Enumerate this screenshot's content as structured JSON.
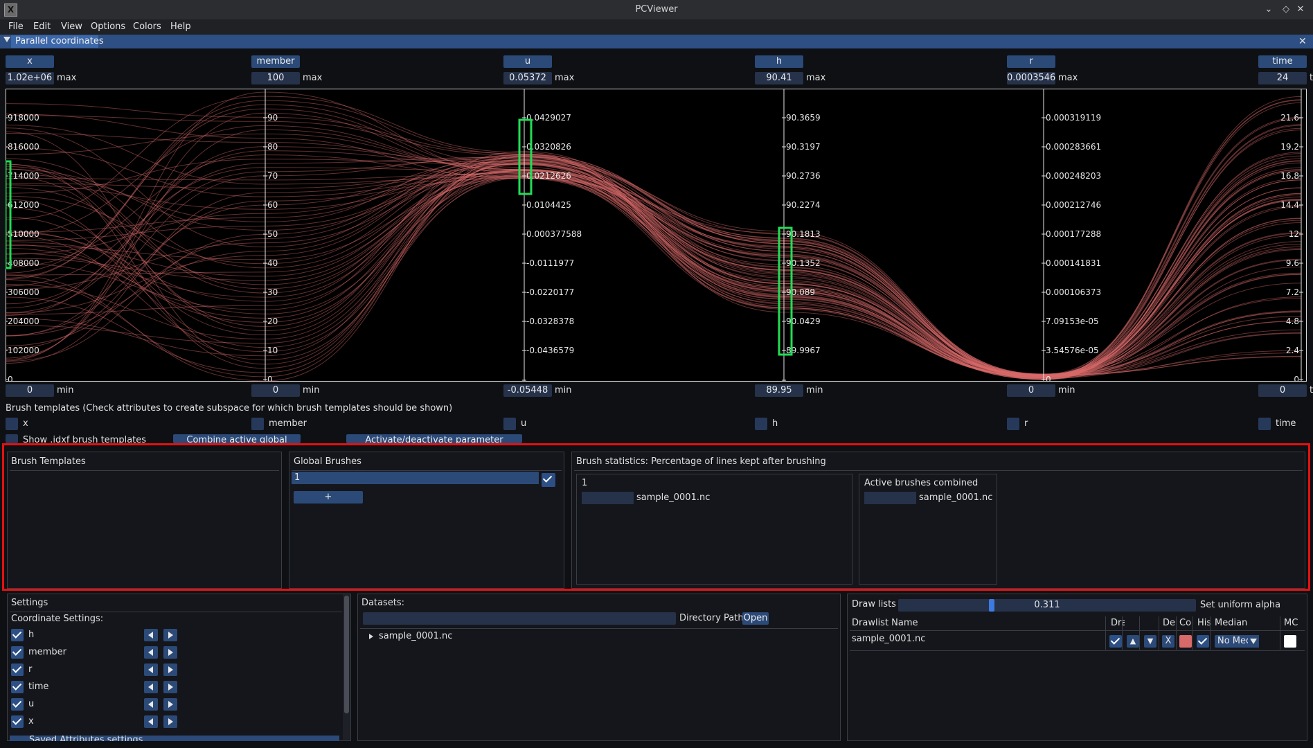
{
  "window": {
    "title": "PCViewer",
    "app_icon": "X",
    "controls": [
      "chevron-down-icon",
      "diamond-icon",
      "close-icon"
    ]
  },
  "menu": [
    "File",
    "Edit",
    "View",
    "Options",
    "Colors",
    "Help"
  ],
  "panel": {
    "title": "Parallel coordinates"
  },
  "axes": [
    {
      "name": "x",
      "max": "1.02e+06",
      "min": "0",
      "ticks": [
        "918000",
        "816000",
        "714000",
        "612000",
        "510000",
        "408000",
        "306000",
        "204000",
        "102000",
        "0"
      ]
    },
    {
      "name": "member",
      "max": "100",
      "min": "0",
      "ticks": [
        "90",
        "80",
        "70",
        "60",
        "50",
        "40",
        "30",
        "20",
        "10",
        "0"
      ]
    },
    {
      "name": "u",
      "max": "0.05372",
      "min": "-0.05448",
      "ticks": [
        "0.0429027",
        "0.0320826",
        "0.0212626",
        "0.0104425",
        "0.000377588",
        "-0.0111977",
        "-0.0220177",
        "-0.0328378",
        "-0.0436579"
      ]
    },
    {
      "name": "h",
      "max": "90.41",
      "min": "89.95",
      "ticks": [
        "90.3659",
        "90.3197",
        "90.2736",
        "90.2274",
        "90.1813",
        "90.1352",
        "90.089",
        "90.0429",
        "89.9967"
      ]
    },
    {
      "name": "r",
      "max": "0.0003546",
      "min": "0",
      "ticks": [
        "0.000319119",
        "0.000283661",
        "0.000248203",
        "0.000212746",
        "0.000177288",
        "0.000141831",
        "0.000106373",
        "7.09153e-05",
        "3.54576e-05",
        "0"
      ]
    },
    {
      "name": "time",
      "max": "24",
      "min": "0",
      "ticks": [
        "21.6",
        "19.2",
        "16.8",
        "14.4",
        "12",
        "9.6",
        "7.2",
        "4.8",
        "2.4",
        "0"
      ]
    }
  ],
  "labels": {
    "max": "max",
    "min": "min",
    "cut": "t"
  },
  "brush_templates": {
    "heading": "Brush templates (Check attributes to create subspace for which brush templates should be shown)",
    "attributes": [
      "x",
      "member",
      "u",
      "h",
      "r",
      "time"
    ],
    "show_idxf": "Show .idxf brush templates",
    "combine_btn": "Combine active global brushes",
    "activate_btn": "Activate/deactivate parameter checkboxes"
  },
  "panels": {
    "brush_templates_title": "Brush Templates",
    "global_brushes": {
      "title": "Global Brushes",
      "items": [
        {
          "name": "1",
          "checked": true
        }
      ],
      "add_label": "+"
    },
    "brush_statistics": {
      "title": "Brush statistics: Percentage of lines kept after brushing",
      "boxes": [
        {
          "title": "1",
          "dataset": "sample_0001.nc"
        },
        {
          "title": "Active brushes combined",
          "dataset": "sample_0001.nc"
        }
      ]
    }
  },
  "settings": {
    "title": "Settings",
    "coordinate_title": "Coordinate Settings:",
    "attributes": [
      {
        "name": "h",
        "checked": true
      },
      {
        "name": "member",
        "checked": true
      },
      {
        "name": "r",
        "checked": true
      },
      {
        "name": "time",
        "checked": true
      },
      {
        "name": "u",
        "checked": true
      },
      {
        "name": "x",
        "checked": true
      }
    ],
    "saved_label": "Saved Attributes settings"
  },
  "datasets": {
    "title": "Datasets:",
    "dir_label": "Directory Path",
    "open_label": "Open",
    "items": [
      "sample_0001.nc"
    ]
  },
  "drawlists": {
    "title": "Draw lists",
    "alpha_value": "0.311",
    "alpha_fraction": 0.311,
    "alpha_label": "Set uniform alpha",
    "columns": [
      "Drawlist Name",
      "Dra",
      "",
      "",
      "De",
      "Co",
      "His",
      "Median",
      "MC"
    ],
    "rows": [
      {
        "name": "sample_0001.nc",
        "delete": "X",
        "median": "No Med"
      }
    ]
  },
  "colors": {
    "lines": "#d96a6a",
    "brush": "#22dd55",
    "accent": "#2b4a78",
    "highlight": "#e51111"
  }
}
